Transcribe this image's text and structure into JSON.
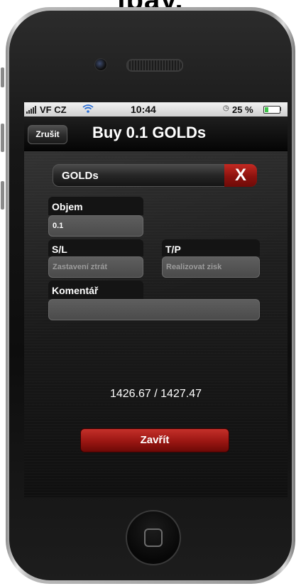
{
  "cropped_heading": "ipay.",
  "status_bar": {
    "carrier": "VF CZ",
    "time": "10:44",
    "battery": "25 %",
    "battery_level": 0.25,
    "wifi_icon": "wifi-icon",
    "signal_icon": "signal-bars-icon"
  },
  "navbar": {
    "cancel_label": "Zrušit",
    "title": "Buy 0.1 GOLDs"
  },
  "symbol": {
    "label": "GOLDs",
    "clear_label": "X"
  },
  "form": {
    "volume_label": "Objem",
    "volume_value": "0.1",
    "sl_label": "S/L",
    "sl_placeholder": "Zastavení ztrát",
    "tp_label": "T/P",
    "tp_placeholder": "Realizovat zisk",
    "comment_label": "Komentář",
    "comment_value": ""
  },
  "prices": "1426.67 / 1427.47",
  "close_button": "Zavřít",
  "colors": {
    "accent_red": "#9a1612",
    "background": "#1c1c1c"
  }
}
